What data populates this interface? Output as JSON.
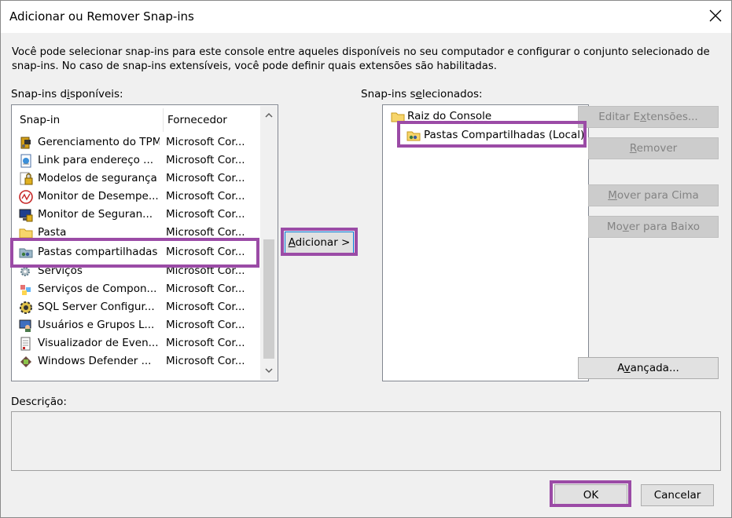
{
  "dialog": {
    "title": "Adicionar ou Remover Snap-ins",
    "intro_line1": "Você pode selecionar snap-ins para este console entre aqueles disponíveis no seu computador e configurar o conjunto selecionado de",
    "intro_line2": "snap-ins. No caso de snap-ins extensíveis, você pode definir quais extensões são habilitadas."
  },
  "available": {
    "label_pre": "Snap-ins d",
    "label_ul": "i",
    "label_post": "sponíveis:",
    "col_snapin": "Snap-in",
    "col_vendor": "Fornecedor",
    "items": [
      {
        "name": "Gerenciamento do TPM",
        "vendor": "Microsoft Cor...",
        "icon": "tpm-icon"
      },
      {
        "name": "Link para endereço ...",
        "vendor": "Microsoft Cor...",
        "icon": "link-icon"
      },
      {
        "name": "Modelos de segurança",
        "vendor": "Microsoft Cor...",
        "icon": "security-template-icon"
      },
      {
        "name": "Monitor de Desempe...",
        "vendor": "Microsoft Cor...",
        "icon": "performance-monitor-icon"
      },
      {
        "name": "Monitor de Seguran...",
        "vendor": "Microsoft Cor...",
        "icon": "security-monitor-icon"
      },
      {
        "name": "Pasta",
        "vendor": "Microsoft Cor...",
        "icon": "folder-icon"
      },
      {
        "name": "Pastas compartilhadas",
        "vendor": "Microsoft Cor...",
        "icon": "shared-folders-icon"
      },
      {
        "name": "Serviços",
        "vendor": "Microsoft Cor...",
        "icon": "services-icon"
      },
      {
        "name": "Serviços de Compon...",
        "vendor": "Microsoft Cor...",
        "icon": "component-services-icon"
      },
      {
        "name": "SQL Server Configur...",
        "vendor": "Microsoft Cor...",
        "icon": "sql-config-icon"
      },
      {
        "name": "Usuários e Grupos L...",
        "vendor": "Microsoft Cor...",
        "icon": "users-groups-icon"
      },
      {
        "name": "Visualizador de Even...",
        "vendor": "Microsoft Cor...",
        "icon": "event-viewer-icon"
      },
      {
        "name": "Windows Defender ...",
        "vendor": "Microsoft Cor...",
        "icon": "defender-icon"
      }
    ]
  },
  "buttons": {
    "add_ul": "A",
    "add_post": "dicionar >",
    "edit_pre": "Editar E",
    "edit_ul": "x",
    "edit_post": "tensões...",
    "remove_ul": "R",
    "remove_post": "emover",
    "move_up_ul": "M",
    "move_up_post": "over para Cima",
    "move_down_pre": "Mo",
    "move_down_ul": "v",
    "move_down_post": "er para Baixo",
    "advanced_pre": "A",
    "advanced_ul": "v",
    "advanced_post": "ançada...",
    "ok": "OK",
    "cancel": "Cancelar"
  },
  "selected": {
    "label_pre": "Snap-ins s",
    "label_ul": "e",
    "label_post": "lecionados:",
    "root": "Raiz do Console",
    "child": "Pastas Compartilhadas (Local)"
  },
  "description": {
    "label": "Descrição:"
  },
  "colors": {
    "highlight": "#9b4ba6",
    "dialog_bg": "#f0f0f0"
  }
}
